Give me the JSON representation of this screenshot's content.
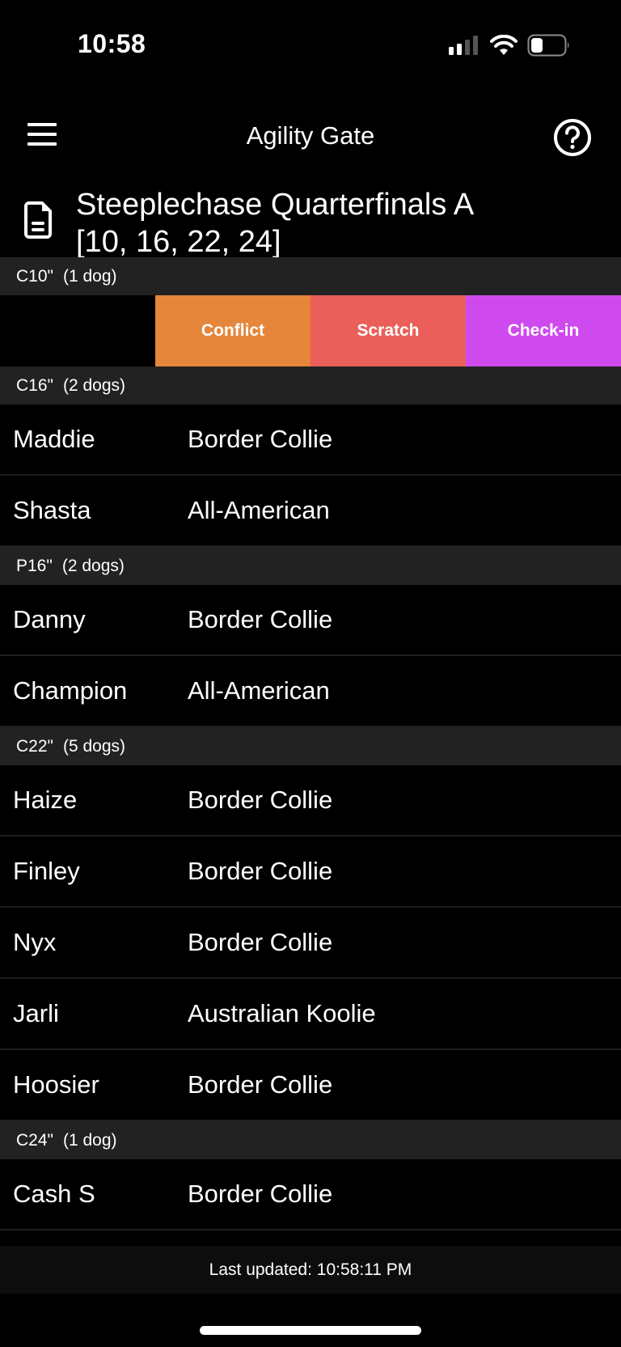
{
  "status_bar": {
    "time": "10:58",
    "icons": [
      "cellular-signal-icon",
      "wifi-icon",
      "battery-icon"
    ]
  },
  "nav": {
    "title": "Agility Gate",
    "menu_icon": "hamburger-menu-icon",
    "help_icon": "help-circle-icon"
  },
  "page": {
    "icon": "document-icon",
    "title": "Steeplechase Quarterfinals A",
    "subtitle": "[10, 16, 22, 24]"
  },
  "swipe_actions": {
    "conflict": {
      "label": "Conflict",
      "color": "#e5863a"
    },
    "scratch": {
      "label": "Scratch",
      "color": "#ea5f5a"
    },
    "checkin": {
      "label": "Check-in",
      "color": "#cf4aee"
    }
  },
  "sections": [
    {
      "height": "C10\"",
      "count": "(1 dog)",
      "dogs": []
    },
    {
      "height": "C16\"",
      "count": "(2 dogs)",
      "dogs": [
        {
          "name": "Maddie",
          "breed": "Border Collie"
        },
        {
          "name": "Shasta",
          "breed": "All-American"
        }
      ]
    },
    {
      "height": "P16\"",
      "count": "(2 dogs)",
      "dogs": [
        {
          "name": "Danny",
          "breed": "Border Collie"
        },
        {
          "name": "Champion",
          "breed": "All-American"
        }
      ]
    },
    {
      "height": "C22\"",
      "count": "(5 dogs)",
      "dogs": [
        {
          "name": "Haize",
          "breed": "Border Collie"
        },
        {
          "name": "Finley",
          "breed": "Border Collie"
        },
        {
          "name": "Nyx",
          "breed": "Border Collie"
        },
        {
          "name": "Jarli",
          "breed": "Australian Koolie"
        },
        {
          "name": "Hoosier",
          "breed": "Border Collie"
        }
      ]
    },
    {
      "height": "C24\"",
      "count": "(1 dog)",
      "dogs": [
        {
          "name": "Cash S",
          "breed": "Border Collie"
        }
      ]
    }
  ],
  "footer": {
    "last_updated": "Last updated: 10:58:11 PM"
  }
}
